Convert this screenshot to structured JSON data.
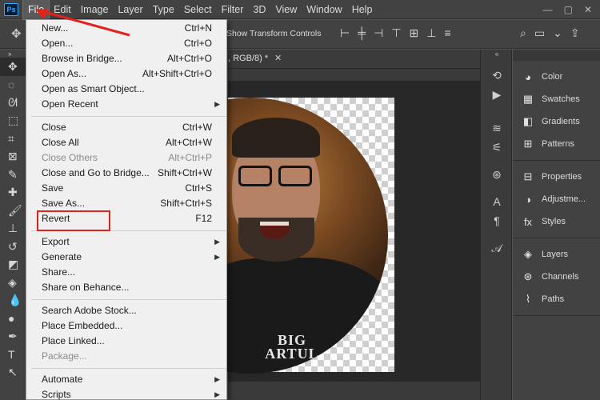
{
  "app_logo": "Ps",
  "menubar": {
    "items": [
      "File",
      "Edit",
      "Image",
      "Layer",
      "Type",
      "Select",
      "Filter",
      "3D",
      "View",
      "Window",
      "Help"
    ],
    "window_controls": [
      "—",
      "▢",
      "✕"
    ]
  },
  "options_bar": {
    "show_transform_controls": "Show Transform Controls"
  },
  "document": {
    "tab_label": ", RGB/8) *",
    "shirt_text_line1": "BIG",
    "shirt_text_line2": "ARTUL"
  },
  "file_menu": {
    "groups": [
      [
        {
          "label": "New...",
          "shortcut": "Ctrl+N"
        },
        {
          "label": "Open...",
          "shortcut": "Ctrl+O"
        },
        {
          "label": "Browse in Bridge...",
          "shortcut": "Alt+Ctrl+O"
        },
        {
          "label": "Open As...",
          "shortcut": "Alt+Shift+Ctrl+O"
        },
        {
          "label": "Open as Smart Object...",
          "shortcut": ""
        },
        {
          "label": "Open Recent",
          "shortcut": "",
          "submenu": true
        }
      ],
      [
        {
          "label": "Close",
          "shortcut": "Ctrl+W"
        },
        {
          "label": "Close All",
          "shortcut": "Alt+Ctrl+W"
        },
        {
          "label": "Close Others",
          "shortcut": "Alt+Ctrl+P",
          "disabled": true
        },
        {
          "label": "Close and Go to Bridge...",
          "shortcut": "Shift+Ctrl+W"
        },
        {
          "label": "Save",
          "shortcut": "Ctrl+S"
        },
        {
          "label": "Save As...",
          "shortcut": "Shift+Ctrl+S",
          "highlighted": true
        },
        {
          "label": "Revert",
          "shortcut": "F12"
        }
      ],
      [
        {
          "label": "Export",
          "shortcut": "",
          "submenu": true
        },
        {
          "label": "Generate",
          "shortcut": "",
          "submenu": true
        },
        {
          "label": "Share...",
          "shortcut": ""
        },
        {
          "label": "Share on Behance...",
          "shortcut": ""
        }
      ],
      [
        {
          "label": "Search Adobe Stock...",
          "shortcut": ""
        },
        {
          "label": "Place Embedded...",
          "shortcut": ""
        },
        {
          "label": "Place Linked...",
          "shortcut": ""
        },
        {
          "label": "Package...",
          "shortcut": "",
          "disabled": true
        }
      ],
      [
        {
          "label": "Automate",
          "shortcut": "",
          "submenu": true
        },
        {
          "label": "Scripts",
          "shortcut": "",
          "submenu": true
        }
      ]
    ]
  },
  "panels": {
    "groups": [
      [
        {
          "label": "Color",
          "icon": "color-icon"
        },
        {
          "label": "Swatches",
          "icon": "swatches-icon"
        },
        {
          "label": "Gradients",
          "icon": "gradients-icon"
        },
        {
          "label": "Patterns",
          "icon": "patterns-icon"
        }
      ],
      [
        {
          "label": "Properties",
          "icon": "properties-icon"
        },
        {
          "label": "Adjustme...",
          "icon": "adjustments-icon"
        },
        {
          "label": "Styles",
          "icon": "styles-icon"
        }
      ],
      [
        {
          "label": "Layers",
          "icon": "layers-icon"
        },
        {
          "label": "Channels",
          "icon": "channels-icon"
        },
        {
          "label": "Paths",
          "icon": "paths-icon"
        }
      ]
    ]
  },
  "colors": {
    "highlight_box": "#e0231c",
    "menu_bg": "#f0f0f0",
    "ui_dark": "#424242"
  }
}
